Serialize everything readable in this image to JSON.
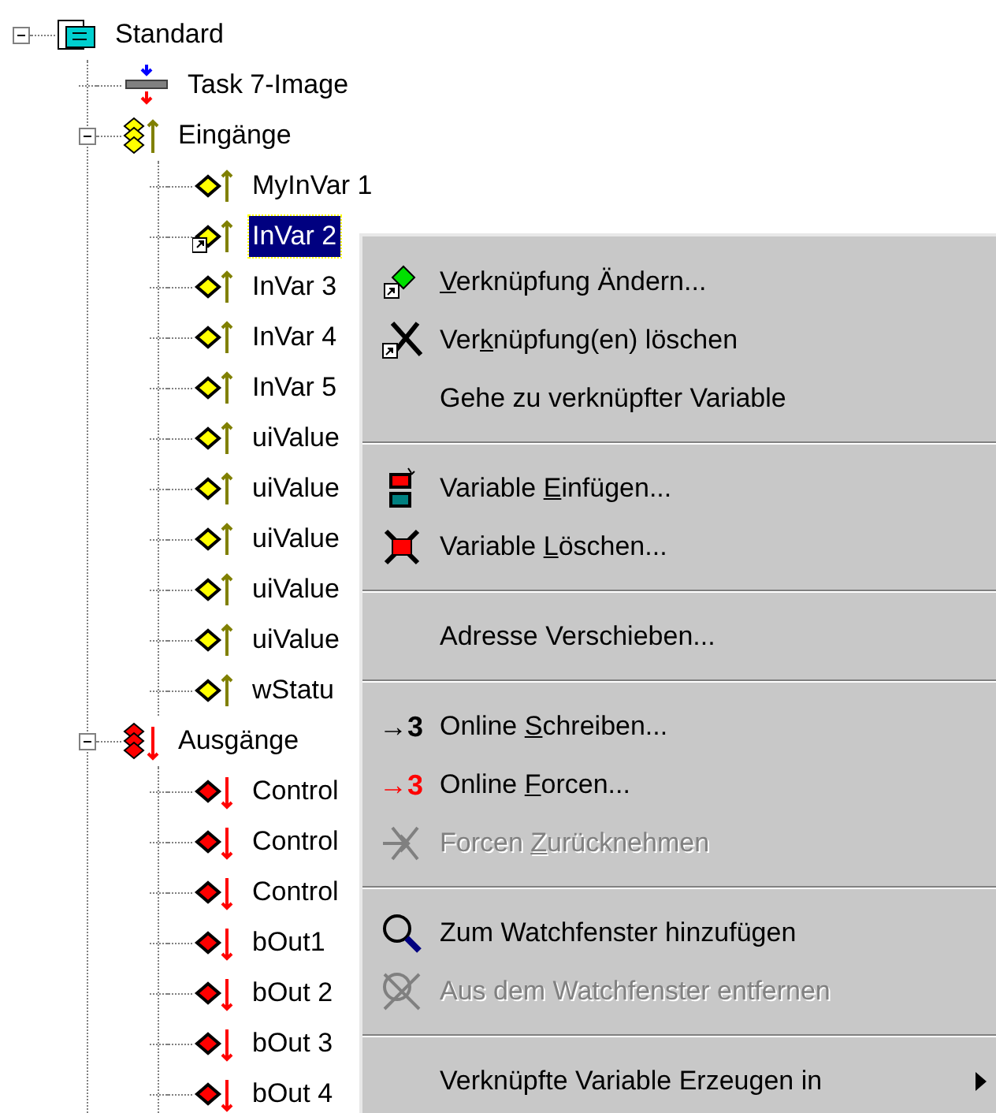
{
  "tree": [
    {
      "label": "Standard",
      "kind": "project",
      "expanded": true,
      "selected": false,
      "children": [
        {
          "label": "Task 7-Image",
          "kind": "task",
          "selected": false
        },
        {
          "label": "Eingänge",
          "kind": "inputs",
          "expanded": true,
          "selected": false,
          "children": [
            {
              "label": "MyInVar 1",
              "kind": "input",
              "linked": false,
              "selected": false
            },
            {
              "label": "InVar 2",
              "kind": "input",
              "linked": true,
              "selected": true
            },
            {
              "label": "InVar 3",
              "kind": "input",
              "linked": false,
              "selected": false
            },
            {
              "label": "InVar 4",
              "kind": "input",
              "linked": false,
              "selected": false
            },
            {
              "label": "InVar 5",
              "kind": "input",
              "linked": false,
              "selected": false
            },
            {
              "label": "uiValue",
              "kind": "input",
              "linked": false,
              "selected": false
            },
            {
              "label": "uiValue",
              "kind": "input",
              "linked": false,
              "selected": false
            },
            {
              "label": "uiValue",
              "kind": "input",
              "linked": false,
              "selected": false
            },
            {
              "label": "uiValue",
              "kind": "input",
              "linked": false,
              "selected": false
            },
            {
              "label": "uiValue",
              "kind": "input",
              "linked": false,
              "selected": false
            },
            {
              "label": "wStatu",
              "kind": "input",
              "linked": false,
              "selected": false
            }
          ]
        },
        {
          "label": "Ausgänge",
          "kind": "outputs",
          "expanded": true,
          "selected": false,
          "children": [
            {
              "label": "Control",
              "kind": "output",
              "linked": false,
              "selected": false
            },
            {
              "label": "Control",
              "kind": "output",
              "linked": false,
              "selected": false
            },
            {
              "label": "Control",
              "kind": "output",
              "linked": false,
              "selected": false
            },
            {
              "label": "bOut1",
              "kind": "output",
              "linked": false,
              "selected": false
            },
            {
              "label": "bOut 2",
              "kind": "output",
              "linked": false,
              "selected": false
            },
            {
              "label": "bOut 3",
              "kind": "output",
              "linked": false,
              "selected": false
            },
            {
              "label": "bOut 4",
              "kind": "output",
              "linked": false,
              "selected": false
            }
          ]
        }
      ]
    }
  ],
  "context_menu": [
    {
      "kind": "item",
      "mnemonic": "V",
      "after": "erknüpfung Ändern...",
      "disabled": false
    },
    {
      "kind": "item",
      "before": "Ver",
      "mnemonic": "k",
      "after": "nüpfung(en) löschen",
      "disabled": false
    },
    {
      "kind": "item",
      "label": "Gehe zu verknüpfter Variable",
      "disabled": false
    },
    {
      "kind": "separator"
    },
    {
      "kind": "item",
      "before": "Variable ",
      "mnemonic": "E",
      "after": "infügen...",
      "disabled": false
    },
    {
      "kind": "item",
      "before": "Variable ",
      "mnemonic": "L",
      "after": "öschen...",
      "disabled": false
    },
    {
      "kind": "separator"
    },
    {
      "kind": "item",
      "label": "Adresse Verschieben...",
      "disabled": false
    },
    {
      "kind": "separator"
    },
    {
      "kind": "item",
      "glyph": "→3",
      "before": "Online ",
      "mnemonic": "S",
      "after": "chreiben...",
      "disabled": false
    },
    {
      "kind": "item",
      "glyph": "→3",
      "before": "Online ",
      "mnemonic": "F",
      "after": "orcen...",
      "disabled": false
    },
    {
      "kind": "item",
      "before": "Forcen ",
      "mnemonic": "Z",
      "after": "urücknehmen",
      "disabled": true
    },
    {
      "kind": "separator"
    },
    {
      "kind": "item",
      "label": "Zum Watchfenster hinzufügen",
      "disabled": false
    },
    {
      "kind": "item",
      "label": "Aus dem Watchfenster entfernen",
      "disabled": true
    },
    {
      "kind": "separator"
    },
    {
      "kind": "item",
      "label": "Verknüpfte Variable Erzeugen in",
      "submenu": true,
      "disabled": false
    }
  ]
}
